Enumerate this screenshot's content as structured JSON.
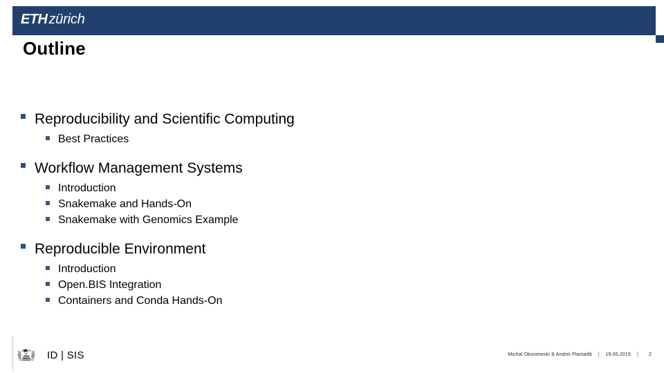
{
  "header": {
    "logo_primary": "ETH",
    "logo_secondary": "zürich",
    "brand_color": "#21406e"
  },
  "title": "Outline",
  "outline": {
    "bullet_glyph": "§",
    "bullet_color_level1": "#2d4f7c",
    "bullet_color_level2": "#3b5a86",
    "groups": [
      {
        "heading": "Reproducibility and Scientific Computing",
        "items": [
          "Best Practices"
        ]
      },
      {
        "heading": "Workflow Management Systems",
        "items": [
          "Introduction",
          "Snakemake and Hands-On",
          "Snakemake with Genomics Example"
        ]
      },
      {
        "heading": "Reproducible Environment",
        "items": [
          "Introduction",
          "Open.BIS Integration",
          "Containers and Conda Hands-On"
        ]
      }
    ]
  },
  "footer": {
    "seal_icon": "eth-seal-icon",
    "department": "ID | SIS",
    "authors": "Michal Okoniewski & Andrei Plamadă",
    "separator": "|",
    "date": "19.06.2019",
    "page_number": "2"
  }
}
